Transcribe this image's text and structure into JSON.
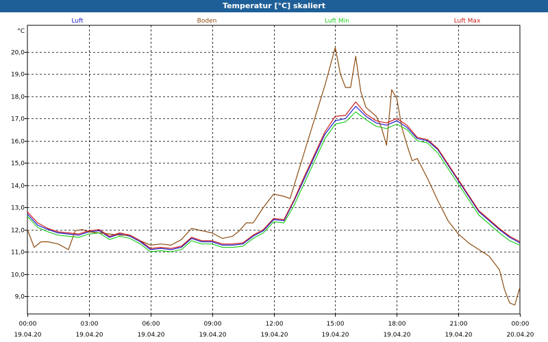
{
  "window": {
    "title": "Temperatur [°C] skaliert"
  },
  "chart_data": {
    "type": "line",
    "title": "Temperatur [°C] skaliert",
    "ylabel": "°C",
    "ylim": [
      8.2,
      21.2
    ],
    "yticks": [
      9.0,
      10.0,
      11.0,
      12.0,
      13.0,
      14.0,
      15.0,
      16.0,
      17.0,
      18.0,
      19.0,
      20.0
    ],
    "ytick_labels": [
      "9,0",
      "10,0",
      "11,0",
      "12,0",
      "13,0",
      "14,0",
      "15,0",
      "16,0",
      "17,0",
      "18,0",
      "19,0",
      "20,0"
    ],
    "xlim": [
      0,
      24
    ],
    "xticks": [
      0,
      3,
      6,
      9,
      12,
      15,
      18,
      21,
      24
    ],
    "xtick_time": [
      "00:00",
      "03:00",
      "06:00",
      "09:00",
      "12:00",
      "15:00",
      "18:00",
      "21:00",
      "00:00"
    ],
    "xtick_date": [
      "19.04.20",
      "19.04.20",
      "19.04.20",
      "19.04.20",
      "19.04.20",
      "19.04.20",
      "19.04.20",
      "19.04.20",
      "20.04.20"
    ],
    "grid": true,
    "legend_position": "top",
    "series": [
      {
        "name": "Luft",
        "color": "#1a1acc",
        "x": [
          0,
          0.5,
          1,
          1.5,
          2,
          2.5,
          3,
          3.5,
          4,
          4.5,
          5,
          5.5,
          6,
          6.5,
          7,
          7.5,
          8,
          8.5,
          9,
          9.5,
          10,
          10.5,
          11,
          11.5,
          12,
          12.5,
          13,
          13.5,
          14,
          14.5,
          15,
          15.5,
          16,
          16.5,
          17,
          17.5,
          18,
          18.5,
          19,
          19.5,
          20,
          20.5,
          21,
          21.5,
          22,
          22.5,
          23,
          23.5,
          24
        ],
        "values": [
          12.7,
          12.2,
          12.0,
          11.85,
          11.8,
          11.75,
          11.9,
          11.95,
          11.65,
          11.8,
          11.7,
          11.45,
          11.1,
          11.15,
          11.1,
          11.2,
          11.6,
          11.45,
          11.45,
          11.3,
          11.3,
          11.35,
          11.7,
          11.95,
          12.45,
          12.4,
          13.3,
          14.3,
          15.3,
          16.3,
          16.9,
          17.0,
          17.55,
          17.1,
          16.8,
          16.7,
          16.9,
          16.6,
          16.1,
          16.0,
          15.6,
          14.9,
          14.2,
          13.5,
          12.8,
          12.4,
          12.0,
          11.65,
          11.4
        ]
      },
      {
        "name": "Boden",
        "color": "#8b4a0f",
        "x": [
          0,
          0.33,
          0.66,
          1,
          1.5,
          2,
          2.33,
          2.66,
          3,
          3.5,
          4,
          4.5,
          5,
          5.5,
          6,
          6.5,
          7,
          7.5,
          8,
          8.5,
          9,
          9.5,
          10,
          10.33,
          10.66,
          11,
          11.5,
          12,
          12.5,
          12.8,
          13,
          13.5,
          14,
          14.5,
          15,
          15.25,
          15.5,
          15.75,
          16,
          16.25,
          16.5,
          16.75,
          17,
          17.25,
          17.5,
          17.75,
          18,
          18.25,
          18.5,
          18.75,
          19,
          19.5,
          20,
          20.5,
          21,
          21.5,
          22,
          22.5,
          23,
          23.25,
          23.5,
          23.75,
          24
        ],
        "values": [
          12.0,
          11.2,
          11.45,
          11.45,
          11.35,
          11.1,
          11.95,
          12.0,
          11.9,
          11.85,
          11.8,
          11.75,
          11.75,
          11.5,
          11.3,
          11.35,
          11.3,
          11.55,
          12.05,
          11.95,
          11.85,
          11.6,
          11.7,
          11.95,
          12.3,
          12.3,
          13.0,
          13.6,
          13.5,
          13.4,
          14.0,
          15.5,
          17.0,
          18.5,
          20.2,
          19.0,
          18.4,
          18.4,
          19.8,
          18.2,
          17.5,
          17.3,
          17.1,
          16.6,
          15.8,
          18.3,
          17.9,
          16.6,
          15.8,
          15.1,
          15.2,
          14.3,
          13.3,
          12.4,
          11.8,
          11.4,
          11.1,
          10.8,
          10.2,
          9.3,
          8.7,
          8.6,
          9.4
        ]
      },
      {
        "name": "Luft Min",
        "color": "#22cc22",
        "x": [
          0,
          0.5,
          1,
          1.5,
          2,
          2.5,
          3,
          3.5,
          4,
          4.5,
          5,
          5.5,
          6,
          6.5,
          7,
          7.5,
          8,
          8.5,
          9,
          9.5,
          10,
          10.5,
          11,
          11.5,
          12,
          12.5,
          13,
          13.5,
          14,
          14.5,
          15,
          15.5,
          16,
          16.5,
          17,
          17.5,
          18,
          18.5,
          19,
          19.5,
          20,
          20.5,
          21,
          21.5,
          22,
          22.5,
          23,
          23.5,
          24
        ],
        "values": [
          12.6,
          12.1,
          11.9,
          11.75,
          11.7,
          11.65,
          11.8,
          11.85,
          11.55,
          11.7,
          11.6,
          11.35,
          11.0,
          11.05,
          11.0,
          11.1,
          11.5,
          11.35,
          11.35,
          11.2,
          11.2,
          11.25,
          11.6,
          11.85,
          12.35,
          12.3,
          13.1,
          14.1,
          15.1,
          16.1,
          16.75,
          16.85,
          17.3,
          16.95,
          16.65,
          16.55,
          16.75,
          16.5,
          16.0,
          15.9,
          15.45,
          14.75,
          14.05,
          13.35,
          12.65,
          12.25,
          11.85,
          11.5,
          11.3
        ]
      },
      {
        "name": "Luft Max",
        "color": "#cc1a1a",
        "x": [
          0,
          0.5,
          1,
          1.5,
          2,
          2.5,
          3,
          3.5,
          4,
          4.5,
          5,
          5.5,
          6,
          6.5,
          7,
          7.5,
          8,
          8.5,
          9,
          9.5,
          10,
          10.5,
          11,
          11.5,
          12,
          12.5,
          13,
          13.5,
          14,
          14.5,
          15,
          15.5,
          16,
          16.5,
          17,
          17.5,
          18,
          18.5,
          19,
          19.5,
          20,
          20.5,
          21,
          21.5,
          22,
          22.5,
          23,
          23.5,
          24
        ],
        "values": [
          12.8,
          12.3,
          12.05,
          11.9,
          11.85,
          11.8,
          11.95,
          12.0,
          11.7,
          11.85,
          11.75,
          11.5,
          11.15,
          11.2,
          11.15,
          11.25,
          11.65,
          11.5,
          11.5,
          11.35,
          11.35,
          11.4,
          11.75,
          12.0,
          12.5,
          12.45,
          13.35,
          14.4,
          15.4,
          16.4,
          17.1,
          17.15,
          17.75,
          17.2,
          16.9,
          16.8,
          17.0,
          16.7,
          16.15,
          16.05,
          15.65,
          14.95,
          14.25,
          13.55,
          12.85,
          12.45,
          12.05,
          11.7,
          11.45
        ]
      }
    ]
  }
}
